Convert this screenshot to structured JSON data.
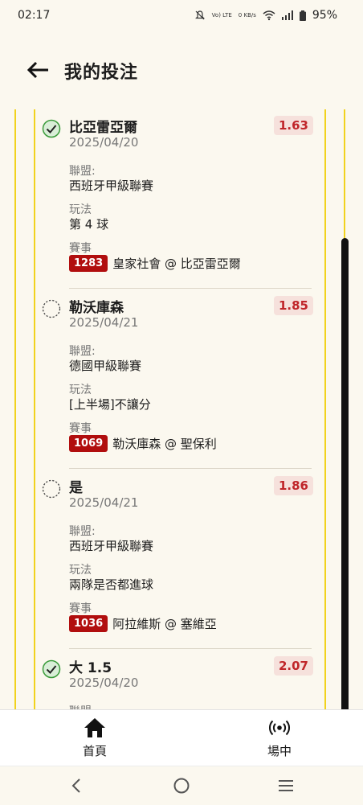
{
  "status_bar": {
    "time": "02:17",
    "network": "Vo) LTE",
    "data_rate": "0 KB/s",
    "battery": "95%"
  },
  "header": {
    "title": "我的投注"
  },
  "labels": {
    "league": "聯盟:",
    "play": "玩法",
    "event": "賽事"
  },
  "bets": [
    {
      "selection": "比亞雷亞爾",
      "date": "2025/04/20",
      "odds": "1.63",
      "status": "won",
      "league": "西班牙甲級聯賽",
      "play": "第 4 球",
      "event_id": "1283",
      "match": "皇家社會 @ 比亞雷亞爾"
    },
    {
      "selection": "勒沃庫森",
      "date": "2025/04/21",
      "odds": "1.85",
      "status": "pending",
      "league": "德國甲級聯賽",
      "play": "[上半場]不讓分",
      "event_id": "1069",
      "match": "勒沃庫森 @ 聖保利"
    },
    {
      "selection": "是",
      "date": "2025/04/21",
      "odds": "1.86",
      "status": "pending",
      "league": "西班牙甲級聯賽",
      "play": "兩隊是否都進球",
      "event_id": "1036",
      "match": "阿拉維斯 @ 塞維亞"
    },
    {
      "selection": "大 1.5",
      "date": "2025/04/20",
      "odds": "2.07",
      "status": "won",
      "league_label_partial": "聯盟"
    }
  ],
  "bottom_nav": [
    {
      "label": "首頁",
      "icon": "home-icon"
    },
    {
      "label": "場中",
      "icon": "live-broadcast-icon"
    }
  ],
  "colors": {
    "accent_yellow": "#f1d21d",
    "odds_text": "#c0262a",
    "odds_bg": "#f6e1dc",
    "event_badge": "#b10e0e",
    "won_green": "#3a9b3a"
  }
}
